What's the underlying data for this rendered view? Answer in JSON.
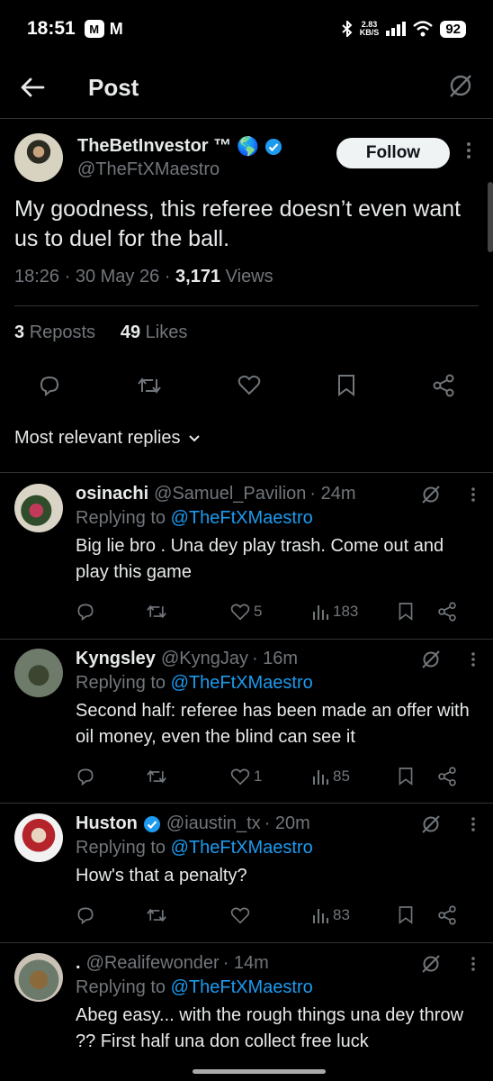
{
  "status_bar": {
    "time": "18:51",
    "badge": "M",
    "mail_icon": "M",
    "net_speed": "2.83",
    "net_unit": "KB/S",
    "battery": "92"
  },
  "header": {
    "title": "Post"
  },
  "post": {
    "author_name": "TheBetInvestor ™",
    "author_emoji": "🌎",
    "handle": "@TheFtXMaestro",
    "follow_label": "Follow",
    "text": "My goodness, this referee doesn’t even want us to duel for the ball.",
    "time": "18:26",
    "date": "30 May 26",
    "views_count": "3,171",
    "views_label": "Views",
    "reposts_count": "3",
    "reposts_label": "Reposts",
    "likes_count": "49",
    "likes_label": "Likes"
  },
  "replies_filter": {
    "label": "Most relevant replies"
  },
  "replies": [
    {
      "name": "osinachi",
      "handle": "@Samuel_Pavilion",
      "time": "· 24m",
      "replying_prefix": "Replying to",
      "replying_to": "@TheFtXMaestro",
      "text": "Big lie bro . Una dey play trash. Come out and play this game",
      "likes": "5",
      "views": "183"
    },
    {
      "name": "Kyngsley",
      "handle": "@KyngJay",
      "time": "· 16m",
      "replying_prefix": "Replying to",
      "replying_to": "@TheFtXMaestro",
      "text": "Second half: referee has been made an offer with oil money, even the blind can see it",
      "likes": "1",
      "views": "85"
    },
    {
      "name": "Huston",
      "handle": "@iaustin_tx",
      "time": "· 20m",
      "replying_prefix": "Replying to",
      "replying_to": "@TheFtXMaestro",
      "text": "How's that a penalty?",
      "likes": "",
      "views": "83"
    },
    {
      "name": ".",
      "handle": "@Realifewonder",
      "time": "· 14m",
      "replying_prefix": "Replying to",
      "replying_to": "@TheFtXMaestro",
      "text": "Abeg easy... with the rough things una dey throw ?? First half una don collect free luck",
      "likes": "",
      "views": ""
    }
  ],
  "colors": {
    "accent": "#1d9bf0",
    "muted": "#71767b",
    "text": "#e7e9ea",
    "background": "#000000",
    "divider": "#2f3336"
  }
}
